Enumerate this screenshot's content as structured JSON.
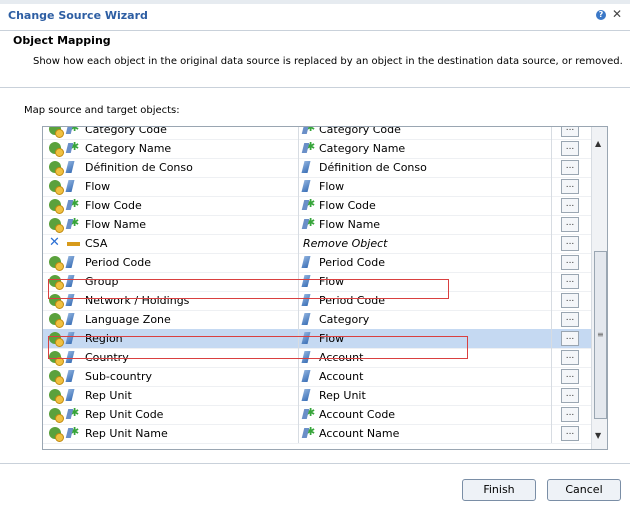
{
  "window": {
    "title": "Change Source Wizard"
  },
  "header": {
    "heading": "Object Mapping",
    "description": "Show how each object in the original data source is replaced by an object in the destination data source, or removed."
  },
  "map_label": "Map source and target objects:",
  "rows": [
    {
      "status": "ok",
      "src_icon": "attribute-icon",
      "source": "Category Code",
      "tgt_icon": "attribute-icon",
      "target": "Category Code",
      "italic": false,
      "selected": false
    },
    {
      "status": "ok",
      "src_icon": "attribute-icon",
      "source": "Category Name",
      "tgt_icon": "attribute-icon",
      "target": "Category Name",
      "italic": false,
      "selected": false
    },
    {
      "status": "ok",
      "src_icon": "dimension-icon",
      "source": "Définition de Conso",
      "tgt_icon": "dimension-icon",
      "target": "Définition de Conso",
      "italic": false,
      "selected": false
    },
    {
      "status": "ok",
      "src_icon": "dimension-icon",
      "source": "Flow",
      "tgt_icon": "dimension-icon",
      "target": "Flow",
      "italic": false,
      "selected": false
    },
    {
      "status": "ok",
      "src_icon": "attribute-icon",
      "source": "Flow Code",
      "tgt_icon": "attribute-icon",
      "target": "Flow Code",
      "italic": false,
      "selected": false
    },
    {
      "status": "ok",
      "src_icon": "attribute-icon",
      "source": "Flow Name",
      "tgt_icon": "attribute-icon",
      "target": "Flow Name",
      "italic": false,
      "selected": false
    },
    {
      "status": "remove",
      "src_icon": "measure-icon",
      "source": "CSA",
      "tgt_icon": "",
      "target": "Remove Object",
      "italic": true,
      "selected": false
    },
    {
      "status": "ok",
      "src_icon": "dimension-icon",
      "source": "Period Code",
      "tgt_icon": "dimension-icon",
      "target": "Period Code",
      "italic": false,
      "selected": false
    },
    {
      "status": "ok",
      "src_icon": "dimension-icon",
      "source": "Group",
      "tgt_icon": "dimension-icon",
      "target": "Flow",
      "italic": false,
      "selected": false
    },
    {
      "status": "ok",
      "src_icon": "dimension-icon",
      "source": "Network / Holdings",
      "tgt_icon": "dimension-icon",
      "target": "Period Code",
      "italic": false,
      "selected": false
    },
    {
      "status": "ok",
      "src_icon": "dimension-icon",
      "source": "Language Zone",
      "tgt_icon": "dimension-icon",
      "target": "Category",
      "italic": false,
      "selected": false
    },
    {
      "status": "ok",
      "src_icon": "dimension-icon",
      "source": "Region",
      "tgt_icon": "dimension-icon",
      "target": "Flow",
      "italic": false,
      "selected": true
    },
    {
      "status": "ok",
      "src_icon": "dimension-icon",
      "source": "Country",
      "tgt_icon": "dimension-icon",
      "target": "Account",
      "italic": false,
      "selected": false
    },
    {
      "status": "ok",
      "src_icon": "dimension-icon",
      "source": "Sub-country",
      "tgt_icon": "dimension-icon",
      "target": "Account",
      "italic": false,
      "selected": false
    },
    {
      "status": "ok",
      "src_icon": "dimension-icon",
      "source": "Rep Unit",
      "tgt_icon": "dimension-icon",
      "target": "Rep Unit",
      "italic": false,
      "selected": false
    },
    {
      "status": "ok",
      "src_icon": "attribute-icon",
      "source": "Rep Unit Code",
      "tgt_icon": "attribute-icon",
      "target": "Account Code",
      "italic": false,
      "selected": false
    },
    {
      "status": "ok",
      "src_icon": "attribute-icon",
      "source": "Rep Unit Name",
      "tgt_icon": "attribute-icon",
      "target": "Account Name",
      "italic": false,
      "selected": false
    }
  ],
  "ellipsis_label": "...",
  "buttons": {
    "finish": "Finish",
    "cancel": "Cancel"
  },
  "colors": {
    "title": "#2d5ea3",
    "selection": "#c5d9f2",
    "highlight": "#d94040"
  }
}
